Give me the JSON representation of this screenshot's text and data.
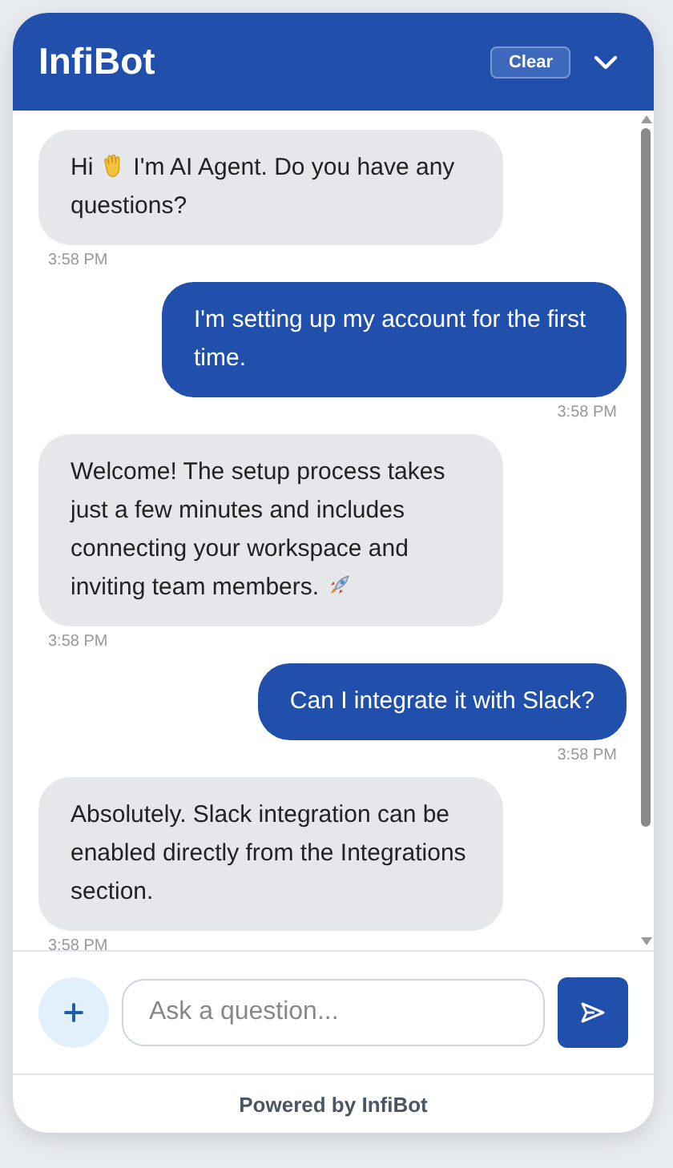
{
  "header": {
    "title": "InfiBot",
    "clear_button": "Clear"
  },
  "messages": [
    {
      "kind": "bot",
      "parts": [
        {
          "kind": "text",
          "text": "Hi"
        },
        {
          "kind": "wave"
        },
        {
          "kind": "text",
          "text": "I'm AI Agent. Do you have any"
        },
        {
          "kind": "break"
        },
        {
          "kind": "text",
          "text": "questions?"
        }
      ],
      "time": "3:58 PM"
    },
    {
      "kind": "user",
      "parts": [
        {
          "kind": "text",
          "text": "I'm setting up my account for the first time."
        }
      ],
      "time": "3:58 PM"
    },
    {
      "kind": "bot",
      "parts": [
        {
          "kind": "text",
          "text": "Welcome! The setup process takes just a few minutes and includes connecting your workspace and"
        },
        {
          "kind": "break"
        },
        {
          "kind": "text",
          "text": "inviting team members."
        },
        {
          "kind": "rocket"
        }
      ],
      "time": "3:58 PM"
    },
    {
      "kind": "user",
      "parts": [
        {
          "kind": "text",
          "text": "Can I integrate it with Slack?"
        }
      ],
      "time": "3:58 PM"
    },
    {
      "kind": "bot",
      "parts": [
        {
          "kind": "text",
          "text": "Absolutely. Slack integration can be enabled directly from the Integrations section."
        }
      ],
      "time": "3:58 PM"
    }
  ],
  "composer": {
    "placeholder": "Ask a question..."
  },
  "footer": "Powered by InfiBot"
}
